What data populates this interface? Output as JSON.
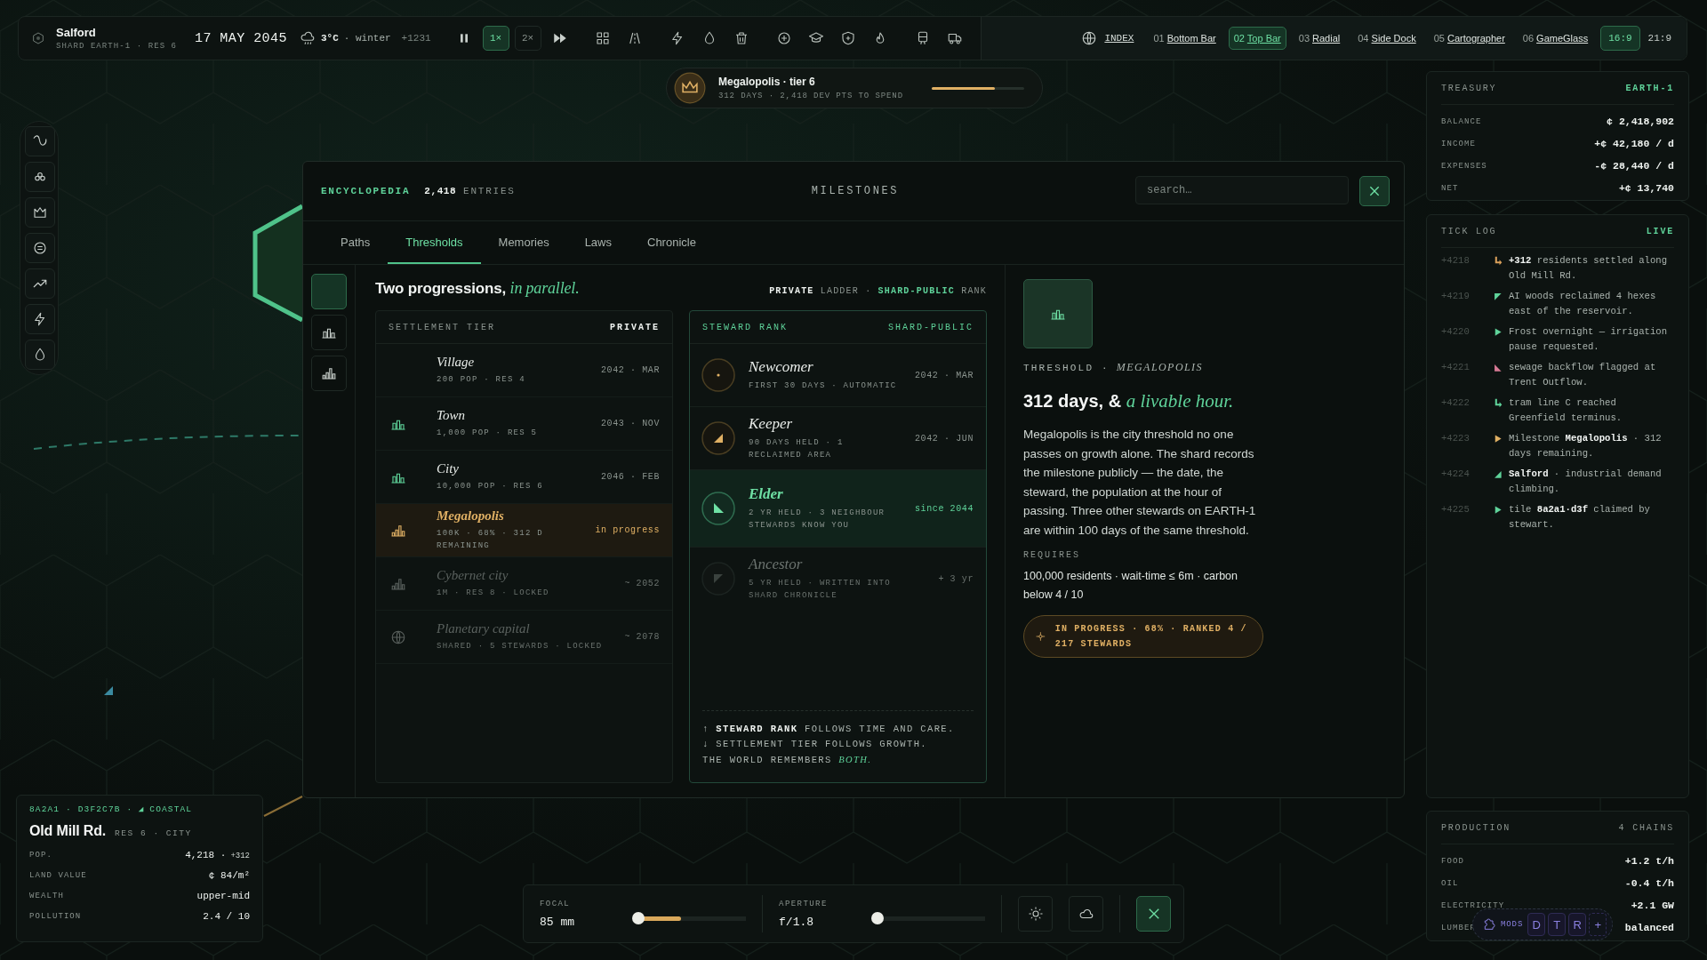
{
  "top_bar": {
    "city": "Salford",
    "shard": "SHARD EARTH-1 · RES 6",
    "date": "17 MAY 2045",
    "temperature": "3°C",
    "season": "· winter",
    "tick": "+1231",
    "speeds": [
      {
        "label": "1×",
        "selected": true
      },
      {
        "label": "2×",
        "selected": false
      }
    ],
    "index_label": "INDEX",
    "layouts": [
      {
        "number": "01",
        "label": "Bottom Bar",
        "selected": false
      },
      {
        "number": "02",
        "label": "Top Bar",
        "selected": true
      },
      {
        "number": "03",
        "label": "Radial",
        "selected": false
      },
      {
        "number": "04",
        "label": "Side Dock",
        "selected": false
      },
      {
        "number": "05",
        "label": "Cartographer",
        "selected": false
      },
      {
        "number": "06",
        "label": "GameGlass",
        "selected": false
      }
    ],
    "aspects": [
      {
        "label": "16:9",
        "selected": true
      },
      {
        "label": "21:9",
        "selected": false
      }
    ]
  },
  "milestone_banner": {
    "title": "Megalopolis · tier 6",
    "subtitle": "312 DAYS · 2,418 DEV PTS TO SPEND",
    "level": 0.68
  },
  "encyclopedia": {
    "title": "ENCYCLOPEDIA",
    "count": "2,418",
    "count_label": "ENTRIES",
    "section": "MILESTONES",
    "search": {
      "placeholder": "search…"
    },
    "tabs": [
      {
        "label": "Paths",
        "selected": false
      },
      {
        "label": "Thresholds",
        "selected": true
      },
      {
        "label": "Memories",
        "selected": false
      },
      {
        "label": "Laws",
        "selected": false
      },
      {
        "label": "Chronicle",
        "selected": false
      }
    ],
    "side_tabs": [
      {
        "selected": true
      },
      {
        "selected": false
      },
      {
        "selected": false
      }
    ],
    "heading": "Two progressions, *in parallel.*",
    "legend": "**PRIVATE** LADDER · *SHARD-PUBLIC* RANK",
    "settlement_tier": {
      "title": "SETTLEMENT TIER",
      "tag": "PRIVATE",
      "tiers": [
        {
          "name": "Village",
          "detail": "200 POP · RES 4",
          "date": "2042 · MAR",
          "selected": false,
          "locked": false
        },
        {
          "name": "Town",
          "detail": "1,000 POP · RES 5",
          "date": "2043 · NOV",
          "selected": false,
          "locked": false
        },
        {
          "name": "City",
          "detail": "10,000 POP · RES 6",
          "date": "2046 · FEB",
          "selected": false,
          "locked": false
        },
        {
          "name": "Megalopolis",
          "detail": "100K · 68% · 312 D REMAINING",
          "date": "in progress",
          "selected": true,
          "locked": false
        },
        {
          "name": "Cybernet city",
          "detail": "1M · RES 8 · LOCKED",
          "date": "~ 2052",
          "selected": false,
          "locked": true
        },
        {
          "name": "Planetary capital",
          "detail": "SHARED · 5 STEWARDS · LOCKED",
          "date": "~ 2078",
          "selected": false,
          "locked": true
        }
      ]
    },
    "steward_rank": {
      "title": "STEWARD RANK",
      "tag": "SHARD-PUBLIC",
      "ranks": [
        {
          "name": "Newcomer",
          "detail": "FIRST 30 DAYS · AUTOMATIC",
          "date": "2042 · MAR",
          "selected": false,
          "locked": false
        },
        {
          "name": "Keeper",
          "detail": "90 DAYS HELD · 1 RECLAIMED AREA",
          "date": "2042 · JUN",
          "selected": false,
          "locked": false
        },
        {
          "name": "Elder",
          "detail": "2 YR HELD · 3 NEIGHBOUR STEWARDS KNOW YOU",
          "date": "since 2044",
          "selected": true,
          "locked": false
        },
        {
          "name": "Ancestor",
          "detail": "5 YR HELD · WRITTEN INTO SHARD CHRONICLE",
          "date": "+ 3 yr",
          "selected": false,
          "locked": true
        }
      ],
      "footnote": "↑ **STEWARD RANK** FOLLOWS TIME AND CARE.\n↓ SETTLEMENT TIER FOLLOWS GROWTH.\nTHE WORLD REMEMBERS *BOTH.*"
    },
    "detail": {
      "eyebrow": "THRESHOLD ·",
      "eyebrow_name": "MEGALOPOLIS",
      "title": "312 days, & *a livable hour.*",
      "body": "Megalopolis is the city threshold no one passes on growth alone. The shard records the milestone publicly — the date, the steward, the population at the hour of passing. Three other stewards on EARTH-1 are within 100 days of the same threshold.",
      "requires_label": "REQUIRES",
      "requires": "100,000 residents · wait-time ≤ 6m · carbon below 4 / 10",
      "status": "IN PROGRESS · 68% · RANKED 4 / 217 STEWARDS"
    }
  },
  "treasury": {
    "title": "TREASURY",
    "tag": "EARTH-1",
    "rows": [
      {
        "label": "BALANCE",
        "value": "¢ 2,418,902"
      },
      {
        "label": "INCOME",
        "value": "+¢ 42,180 / d"
      },
      {
        "label": "EXPENSES",
        "value": "-¢ 28,440 / d"
      },
      {
        "label": "NET",
        "value": "+¢ 13,740"
      }
    ]
  },
  "tick_log": {
    "title": "TICK LOG",
    "tag": "LIVE",
    "entries": [
      {
        "tick": "+4218",
        "color": "#d9a05b",
        "text": "**+312** residents settled along Old Mill Rd."
      },
      {
        "tick": "+4219",
        "color": "#5fd39a",
        "text": "AI woods reclaimed 4 hexes east of the reservoir."
      },
      {
        "tick": "+4220",
        "color": "#5fd39a",
        "text": "Frost overnight — irrigation pause requested."
      },
      {
        "tick": "+4221",
        "color": "#d77a95",
        "text": "sewage backflow flagged at Trent Outflow."
      },
      {
        "tick": "+4222",
        "color": "#5fd39a",
        "text": "tram line C reached Greenfield terminus."
      },
      {
        "tick": "+4223",
        "color": "#e0b064",
        "text": "Milestone **Megalopolis** · 312 days remaining."
      },
      {
        "tick": "+4224",
        "color": "#5fd39a",
        "text": "**Salford** · industrial demand climbing."
      },
      {
        "tick": "+4225",
        "color": "#5fd39a",
        "text": "tile **8a2a1·d3f** claimed by stewart."
      }
    ]
  },
  "production": {
    "title": "PRODUCTION",
    "tag": "4 CHAINS",
    "rows": [
      {
        "label": "FOOD",
        "value": "+1.2 t/h"
      },
      {
        "label": "OIL",
        "value": "-0.4 t/h"
      },
      {
        "label": "ELECTRICITY",
        "value": "+2.1 GW"
      },
      {
        "label": "LUMBER",
        "value": "balanced"
      }
    ]
  },
  "mods_bar": {
    "label": "MODS",
    "keys": [
      "D",
      "T",
      "R"
    ],
    "add": "+"
  },
  "tile_card": {
    "id": "8A2A1 · D3F2C7B ·",
    "terrain": "COASTAL",
    "name": "Old Mill Rd.",
    "meta": "RES 6 · CITY",
    "rows": [
      {
        "label": "POP.",
        "value": "4,218 ·",
        "delta": "+312"
      },
      {
        "label": "LAND VALUE",
        "value": "¢ 84/m²"
      },
      {
        "label": "WEALTH",
        "value": "upper-mid"
      },
      {
        "label": "POLLUTION",
        "value": "2.4 / 10"
      }
    ]
  },
  "camera": {
    "focal": {
      "label": "FOCAL",
      "value": "85 mm",
      "level": 0.42
    },
    "aperture": {
      "label": "APERTURE",
      "value": "f/1.8",
      "level": 0.03
    }
  }
}
